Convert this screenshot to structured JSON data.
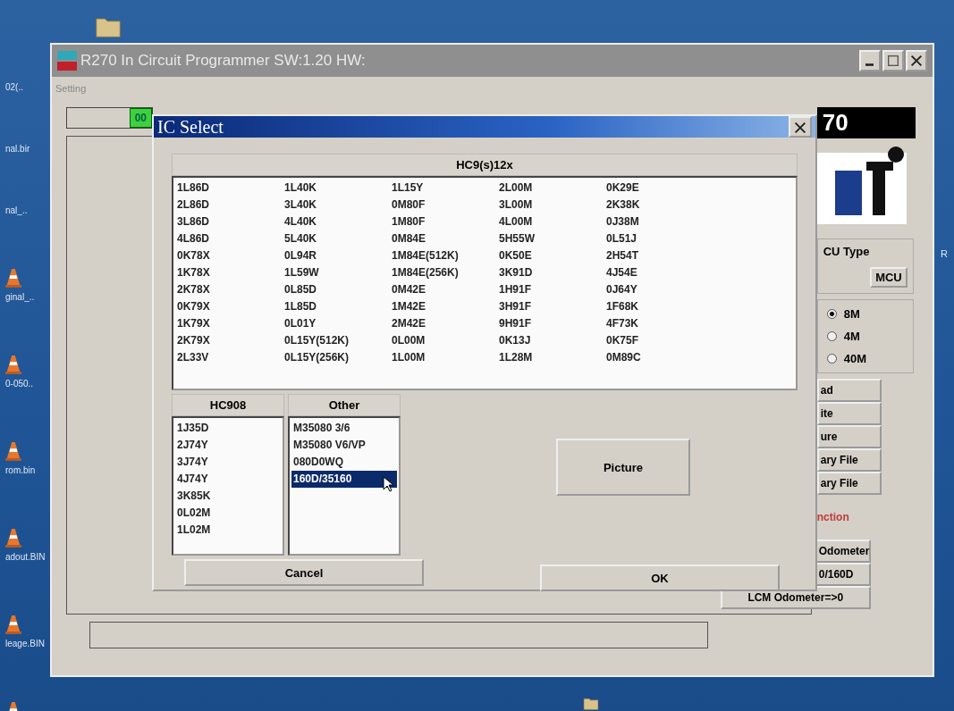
{
  "desktop": {
    "left_icons": [
      {
        "label": "02(..",
        "kind": "file"
      },
      {
        "label": "nal.bir",
        "kind": "file"
      },
      {
        "label": "nal_..",
        "kind": "file"
      },
      {
        "label": "ginal_..",
        "kind": "cone"
      },
      {
        "label": "0-050..",
        "kind": "cone"
      },
      {
        "label": "rom.bin",
        "kind": "cone"
      },
      {
        "label": "adout.BIN",
        "kind": "cone"
      },
      {
        "label": "leage.BIN",
        "kind": "cone"
      }
    ],
    "right_label": "R"
  },
  "main_window": {
    "title": "R270 In Circuit Programmer SW:1.20 HW:",
    "menu": [
      "Setting"
    ],
    "counter": "00",
    "logo_text": "70",
    "mcu_type_label": "CU Type",
    "mcu_button": "MCU",
    "memory_options": [
      {
        "label": "8M",
        "selected": true
      },
      {
        "label": "4M",
        "selected": false
      },
      {
        "label": "40M",
        "selected": false
      }
    ],
    "action_buttons": [
      "ad",
      "ite",
      "ure",
      "ary File",
      "ary File"
    ],
    "function_label": "nction",
    "function_buttons": [
      "Odometer",
      "0/160D",
      "LCM Odometer=>0"
    ]
  },
  "dialog": {
    "title": "IC Select",
    "hc9s12x": {
      "header": "HC9(s)12x",
      "columns": [
        [
          "1L86D",
          "2L86D",
          "3L86D",
          "4L86D",
          "0K78X",
          "1K78X",
          "2K78X",
          "0K79X",
          "1K79X",
          "2K79X",
          "2L33V"
        ],
        [
          "1L40K",
          "3L40K",
          "4L40K",
          "5L40K",
          "0L94R",
          "1L59W",
          "0L85D",
          "1L85D",
          "0L01Y",
          "0L15Y(512K)",
          "0L15Y(256K)"
        ],
        [
          "1L15Y",
          "0M80F",
          "1M80F",
          "0M84E",
          "1M84E(512K)",
          "1M84E(256K)",
          "0M42E",
          "1M42E",
          "2M42E",
          "0L00M",
          "1L00M"
        ],
        [
          "2L00M",
          "3L00M",
          "4L00M",
          "5H55W",
          "0K50E",
          "3K91D",
          "1H91F",
          "3H91F",
          "9H91F",
          "0K13J",
          "1L28M"
        ],
        [
          "0K29E",
          "2K38K",
          "0J38M",
          "0L51J",
          "2H54T",
          "4J54E",
          "0J64Y",
          "1F68K",
          "4F73K",
          "0K75F",
          "0M89C"
        ]
      ]
    },
    "hc908": {
      "header": "HC908",
      "items": [
        "1J35D",
        "2J74Y",
        "3J74Y",
        "4J74Y",
        "3K85K",
        "0L02M",
        "1L02M"
      ]
    },
    "other": {
      "header": "Other",
      "items": [
        {
          "label": "M35080 3/6",
          "selected": false
        },
        {
          "label": "M35080 V6/VP",
          "selected": false
        },
        {
          "label": "080D0WQ",
          "selected": false
        },
        {
          "label": "160D/35160",
          "selected": true
        }
      ]
    },
    "picture_button": "Picture",
    "cancel_button": "Cancel",
    "ok_button": "OK"
  }
}
